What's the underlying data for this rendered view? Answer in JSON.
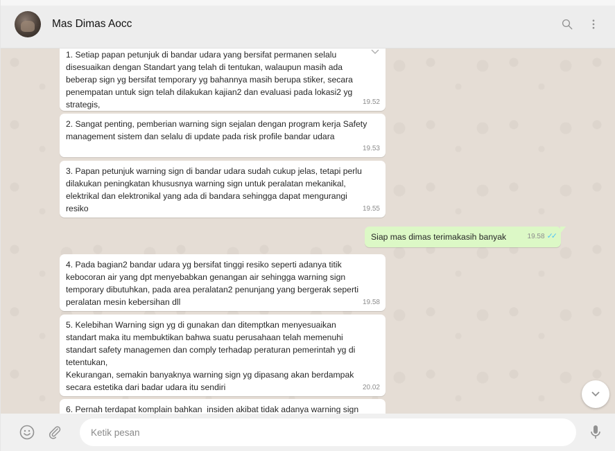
{
  "header": {
    "contact_name": "Mas Dimas Aocc"
  },
  "messages": [
    {
      "direction": "in",
      "text": "1. Setiap papan petunjuk di bandar udara yang bersifat permanen selalu\ndisesuaikan dengan Standart yang telah di tentukan, walaupun masih ada\nbeberap sign yg bersifat temporary yg bahannya masih berupa stiker, secara\npenempatan untuk sign telah dilakukan kajian2 dan evaluasi pada lokasi2 yg\nstrategis,",
      "time": "19.52"
    },
    {
      "direction": "in",
      "text": "2. Sangat penting, pemberian warning sign sejalan dengan program kerja Safety\nmanagement sistem dan selalu di update pada risk profile bandar udara",
      "time": "19.53"
    },
    {
      "direction": "in",
      "text": "3. Papan petunjuk warning sign di bandar udara sudah cukup jelas, tetapi perlu\ndilakukan peningkatan khususnya warning sign untuk peralatan mekanikal,\nelektrikal dan elektronikal yang ada di bandara sehingga dapat mengurangi\nresiko",
      "time": "19.55"
    },
    {
      "direction": "out",
      "text": "Siap mas dimas terimakasih banyak",
      "time": "19.58"
    },
    {
      "direction": "in",
      "text": "4. Pada bagian2 bandar udara yg bersifat tinggi resiko seperti adanya titik\nkebocoran air yang dpt menyebabkan genangan air sehingga warning sign\ntemporary dibutuhkan, pada area peralatan2 penunjang yang bergerak seperti\nperalatan mesin kebersihan dll",
      "time": "19.58"
    },
    {
      "direction": "in",
      "text": "5. Kelebihan Warning sign yg di gunakan dan ditemptkan menyesuaikan\nstandart maka itu membuktikan bahwa suatu perusahaan telah memenuhi\nstandart safety managemen dan comply terhadap peraturan pemerintah yg di\ntetentukan,\nKekurangan, semakin banyaknya warning sign yg dipasang akan berdampak\nsecara estetika dari badar udara itu sendiri",
      "time": "20.02"
    },
    {
      "direction": "in",
      "text": "6. Pernah terdapat komplain bahkan  insiden akibat tidak adanya warning sign",
      "time": ""
    }
  ],
  "composer": {
    "placeholder": "Ketik pesan"
  },
  "colors": {
    "chat_bg": "#e5ddd5",
    "outgoing_bubble": "#dcf8c6",
    "read_ticks": "#4fc3f7",
    "header_bg": "#ededed"
  },
  "icons": {
    "header": [
      "search-icon",
      "menu-dots-icon"
    ],
    "composer": [
      "emoji-icon",
      "attach-icon",
      "microphone-icon"
    ],
    "scroll": "chevron-down-icon"
  }
}
